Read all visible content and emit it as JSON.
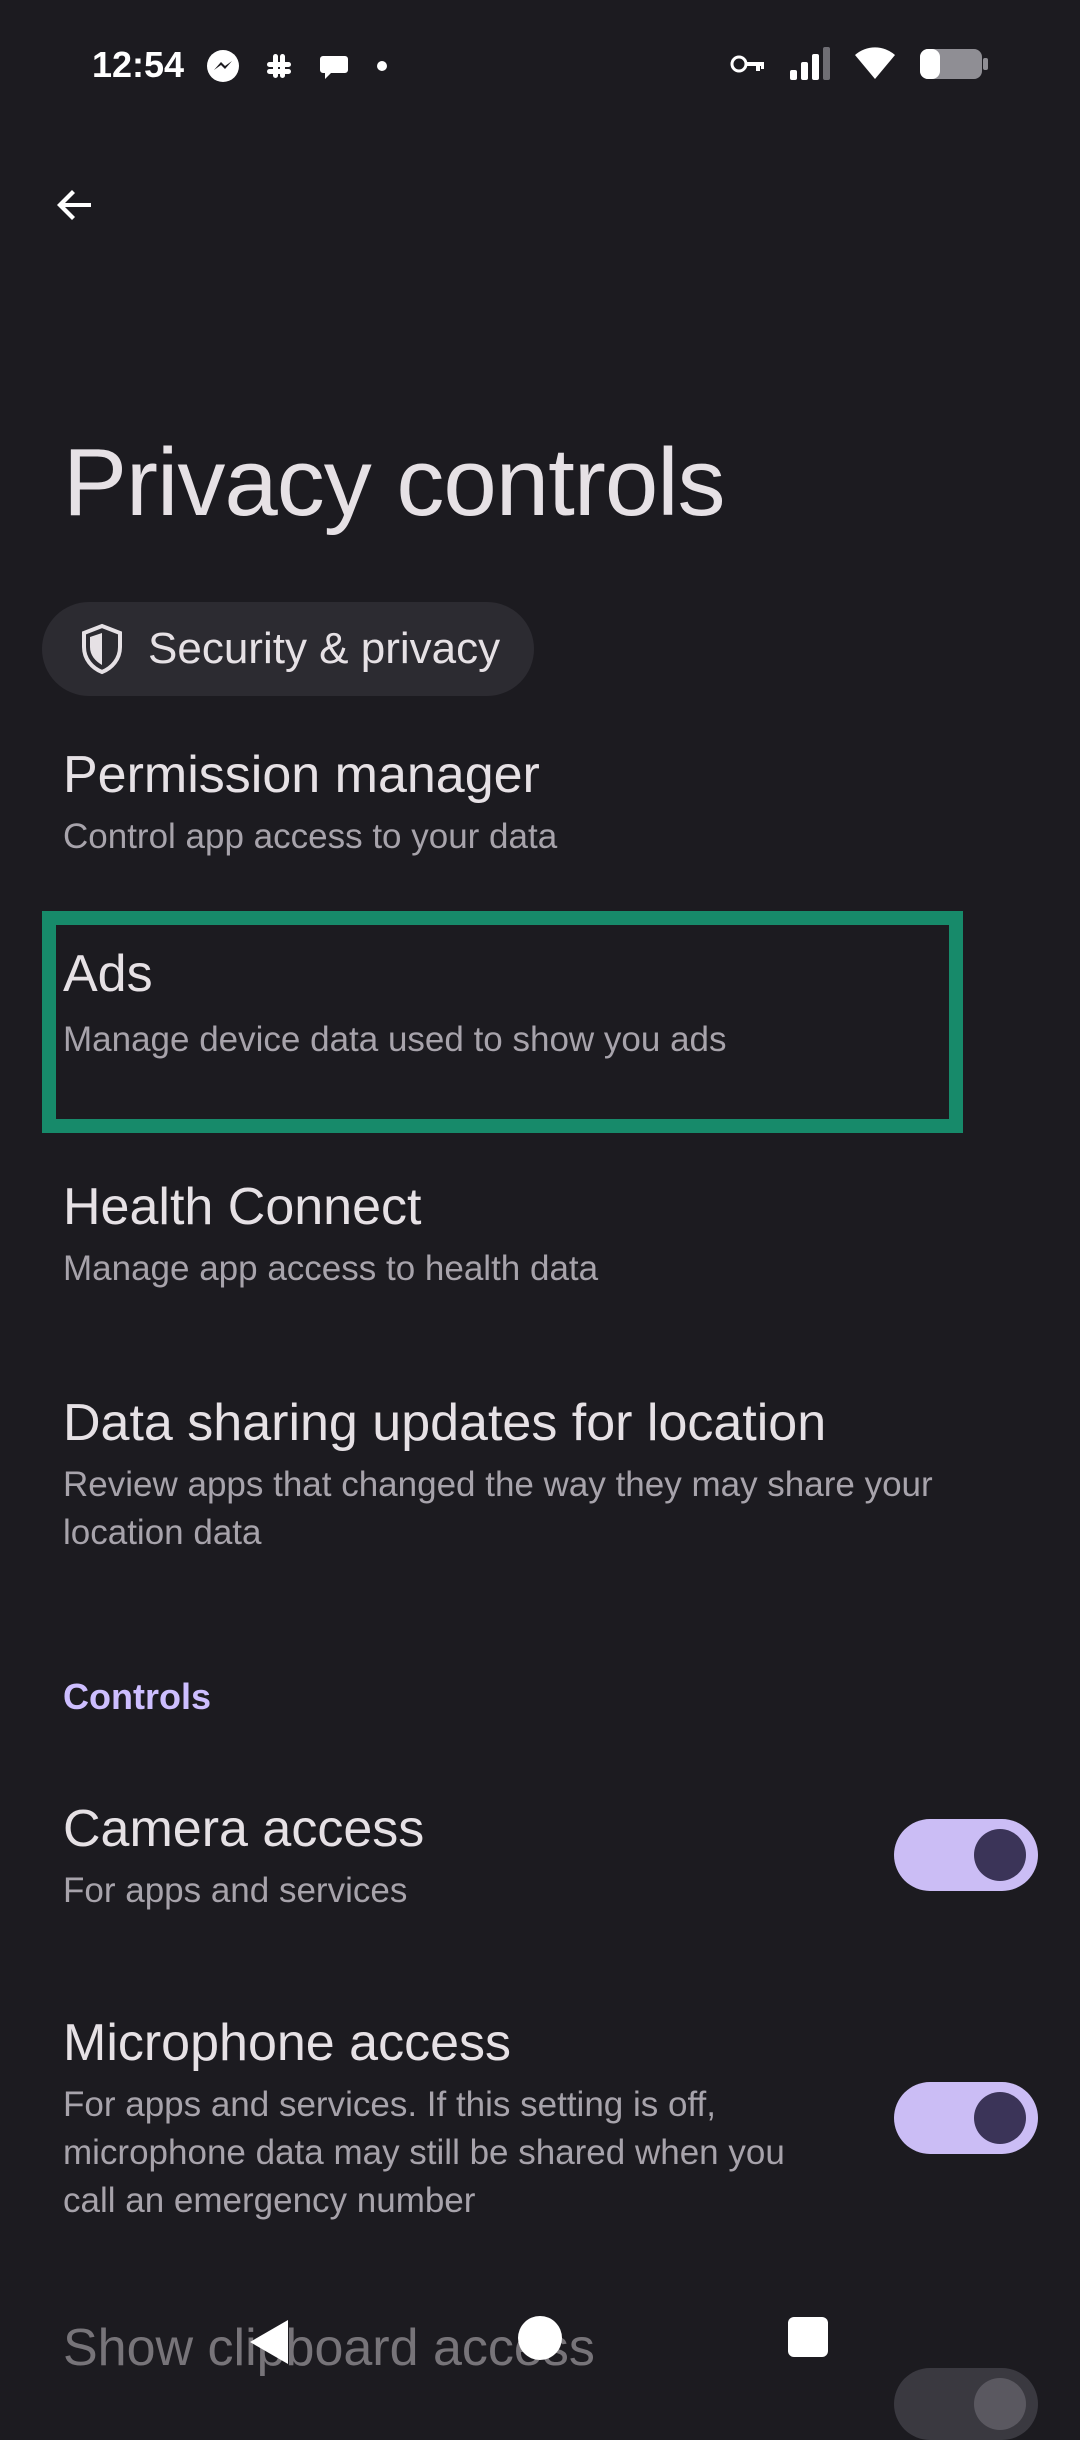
{
  "status": {
    "time": "12:54",
    "left_icons": [
      "messenger-icon",
      "slack-icon",
      "chat-icon",
      "dot-icon"
    ],
    "right_icons": [
      "vpn-key-icon",
      "signal-icon",
      "wifi-icon",
      "battery-icon"
    ]
  },
  "header": {
    "title": "Privacy controls",
    "chip_label": "Security & privacy"
  },
  "items": [
    {
      "title": "Permission manager",
      "subtitle": "Control app access to your data"
    },
    {
      "title": "Ads",
      "subtitle": "Manage device data used to show you ads"
    },
    {
      "title": "Health Connect",
      "subtitle": "Manage app access to health data"
    },
    {
      "title": "Data sharing updates for location",
      "subtitle_line1": "Review apps that changed the way they may share your",
      "subtitle_line2": "location data"
    }
  ],
  "controls": {
    "section_label": "Controls",
    "camera": {
      "title": "Camera access",
      "subtitle": "For apps and services",
      "enabled": true
    },
    "microphone": {
      "title": "Microphone access",
      "subtitle_line1": "For apps and services. If this setting is off,",
      "subtitle_line2": "microphone data may still be shared when you",
      "subtitle_line3": "call an emergency number",
      "enabled": true
    },
    "clipboard": {
      "title": "Show clipboard access"
    }
  },
  "colors": {
    "background": "#1c1b20",
    "accent": "#cbbdf5",
    "highlight_border": "#178a6a",
    "section_label": "#cdbeff"
  }
}
